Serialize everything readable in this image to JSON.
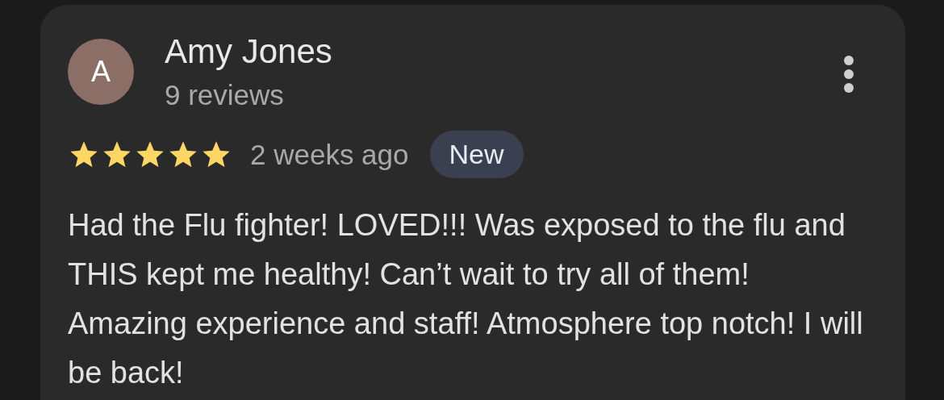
{
  "review": {
    "avatar_letter": "A",
    "author": "Amy Jones",
    "author_meta": "9 reviews",
    "stars": 5,
    "time": "2 weeks ago",
    "badge": "New",
    "text": "Had the Flu fighter! LOVED!!! Was exposed to the flu and THIS kept me healthy! Can’t wait to try all of them! Amazing experience and staff! Atmosphere top notch! I will be back!"
  }
}
